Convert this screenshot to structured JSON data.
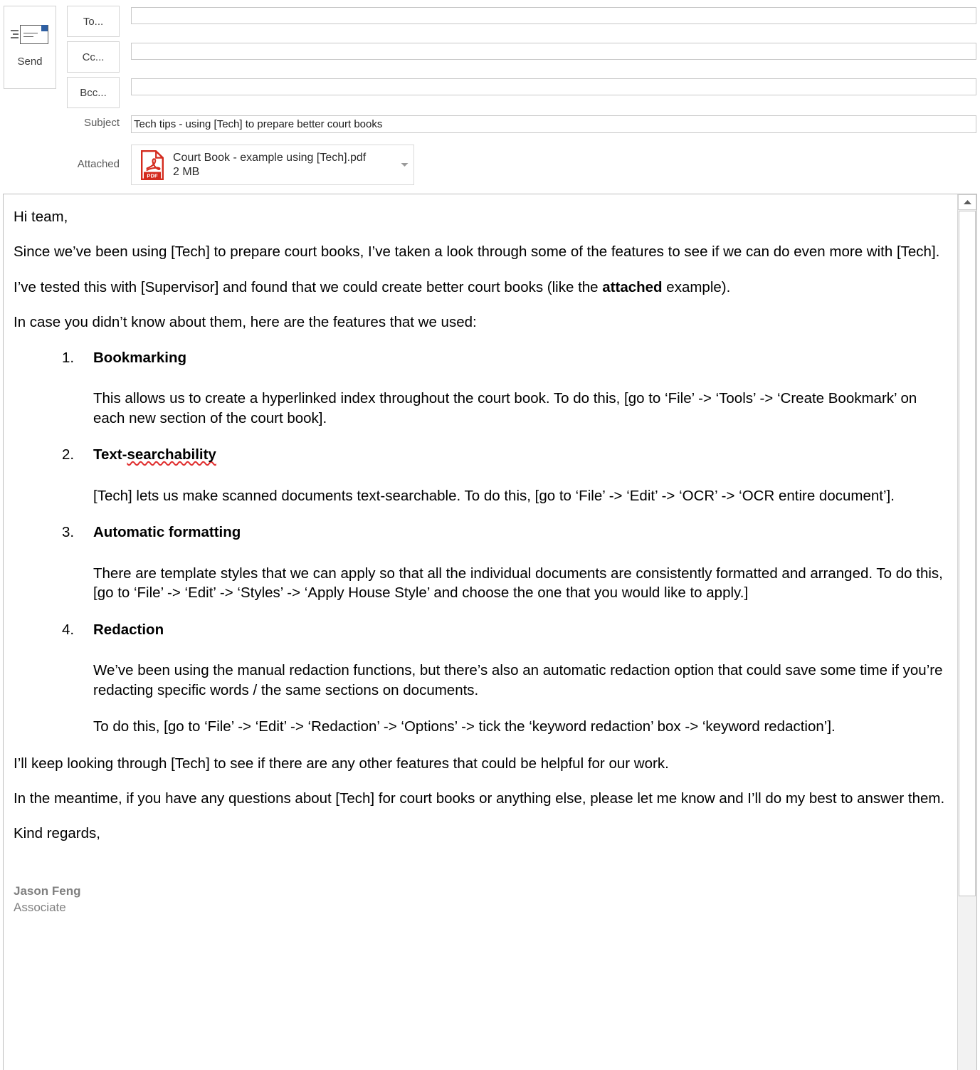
{
  "compose": {
    "send_button": {
      "label": "Send",
      "icon": "send-envelope-icon"
    },
    "recipients": [
      {
        "button_label": "To...",
        "value": "",
        "field": "to"
      },
      {
        "button_label": "Cc...",
        "value": "",
        "field": "cc"
      },
      {
        "button_label": "Bcc...",
        "value": "",
        "field": "bcc"
      }
    ],
    "subject": {
      "label": "Subject",
      "value": "Tech tips - using [Tech] to prepare better court books"
    },
    "attached": {
      "label": "Attached",
      "file_name": "Court Book - example using [Tech].pdf",
      "file_size": "2 MB",
      "file_type_badge": "PDF",
      "dropdown_icon": "chevron-down-icon"
    }
  },
  "body": {
    "greeting": "Hi team,",
    "paragraph_1": "Since we’ve been using [Tech] to prepare court books, I’ve taken a look through some of the features to see if we can do even more with [Tech].",
    "paragraph_2_pre": "I’ve tested this with [Supervisor] and found that we could create better court books (like the ",
    "paragraph_2_bold": "attached",
    "paragraph_2_post": " example).",
    "paragraph_3": "In case you didn’t know about them, here are the features that we used:",
    "features": [
      {
        "number": "1.",
        "title": "Bookmarking",
        "title_misspelled": "",
        "paragraphs": [
          "This allows us to create a hyperlinked index throughout the court book. To do this, [go to ‘File’ -> ‘Tools’ -> ‘Create Bookmark’ on each new section of the court book]."
        ]
      },
      {
        "number": "2.",
        "title_prefix": "Text-",
        "title_misspelled": "searchability",
        "title": "Text-searchability",
        "paragraphs": [
          "[Tech] lets us make scanned documents text-searchable. To do this, [go to ‘File’ -> ‘Edit’ -> ‘OCR’ -> ‘OCR entire document’]."
        ]
      },
      {
        "number": "3.",
        "title": "Automatic formatting",
        "paragraphs": [
          "There are template styles that we can apply so that all the individual documents are consistently formatted and arranged. To do this, [go to ‘File’ -> ‘Edit’ -> ‘Styles’ -> ‘Apply House Style’ and choose the one that you would like to apply.]"
        ]
      },
      {
        "number": "4.",
        "title": "Redaction",
        "paragraphs": [
          "We’ve been using the manual redaction functions, but there’s also an automatic redaction option that could save some time if you’re redacting specific words / the same sections on documents.",
          "To do this, [go to ‘File’ -> ‘Edit’ -> ‘Redaction’ -> ‘Options’ -> tick the ‘keyword redaction’ box -> ‘keyword redaction’]."
        ]
      }
    ],
    "paragraph_4": "I’ll keep looking through [Tech] to see if there are any other features that could be helpful for our work.",
    "paragraph_5": "In the meantime, if you have any questions about [Tech] for court books or anything else, please let me know and I’ll do my best to answer them.",
    "sign_off": "Kind regards,",
    "signature": {
      "name": "Jason Feng",
      "role": "Associate"
    }
  },
  "scrollbar": {
    "up_arrow_icon": "triangle-up-icon"
  },
  "colors": {
    "accent_blue": "#2e5fa3",
    "pdf_red": "#d42b1e",
    "spellcheck_red": "#e03030",
    "signature_gray": "#808080",
    "border_gray": "#c8c8c8"
  }
}
